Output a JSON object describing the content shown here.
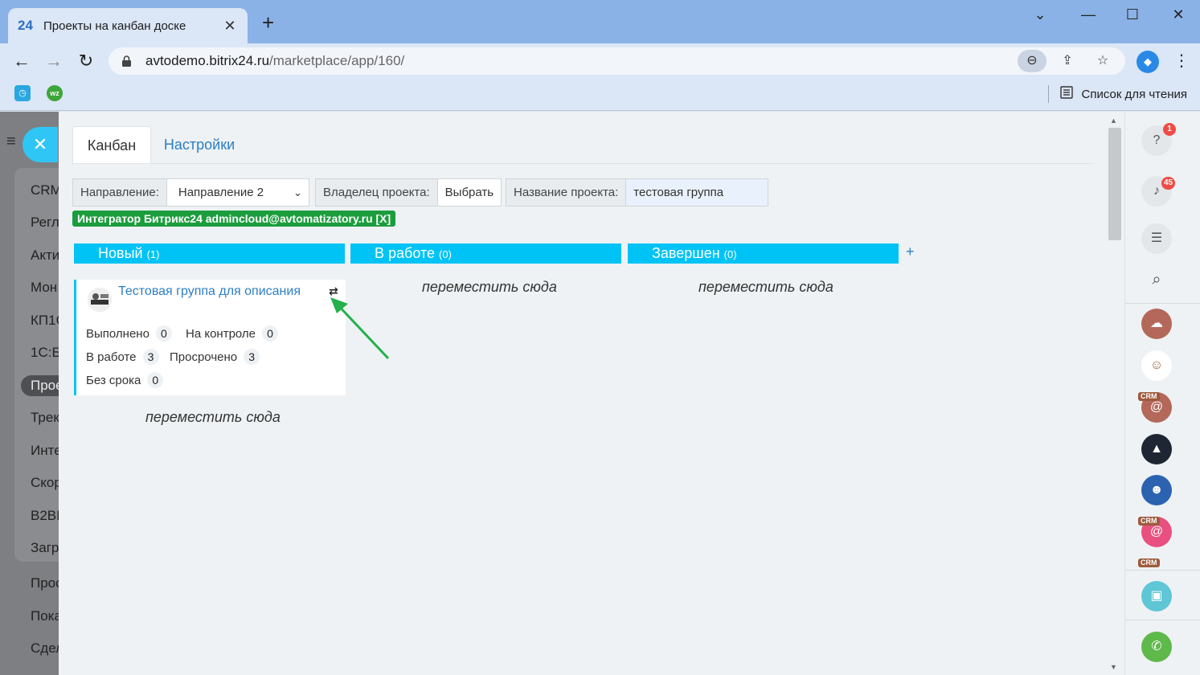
{
  "browser": {
    "tab_logo": "24",
    "tab_title": "Проекты на канбан доске",
    "tab_close": "✕",
    "new_tab": "+",
    "url_host": "avtodemo.bitrix24.ru",
    "url_path": "/marketplace/app/160/",
    "reading_list": "Список для чтения",
    "bookmark_wz": "wz"
  },
  "left_sidebar": {
    "items": [
      "CRM",
      "Регл",
      "Акти",
      "Мон",
      "КП1С",
      "1С:Б",
      "Проє",
      "Трек",
      "Инте",
      "Скор",
      "B2BI",
      "Загр",
      "Прос",
      "Пока",
      "Сдел"
    ]
  },
  "tabs": {
    "kanban": "Канбан",
    "settings": "Настройки"
  },
  "filter": {
    "direction_label": "Направление:",
    "direction_value": "Направление 2",
    "owner_label": "Владелец проекта:",
    "owner_button": "Выбрать",
    "name_label": "Название проекта:",
    "name_value": "тестовая группа"
  },
  "badge": "Интегратор Битрикс24 admincloud@avtomatizatory.ru [X]",
  "columns": [
    {
      "title": "Новый",
      "count": "(1)"
    },
    {
      "title": "В работе",
      "count": "(0)"
    },
    {
      "title": "Завершен",
      "count": "(0)"
    }
  ],
  "add_column": "+",
  "card": {
    "title": "Тестовая группа для описания",
    "move_icon": "⇄",
    "stats": {
      "done_label": "Выполнено",
      "done": "0",
      "control_label": "На контроле",
      "control": "0",
      "work_label": "В работе",
      "work": "3",
      "overdue_label": "Просрочено",
      "overdue": "3",
      "nodeadline_label": "Без срока",
      "nodeadline": "0"
    }
  },
  "drop_text": "переместить сюда",
  "right_sidebar": {
    "help_badge": "1",
    "notif_badge": "45",
    "crm_label": "CRM"
  },
  "colors": {
    "column_header": "#00c3f5",
    "green_badge": "#1c9d3d",
    "link": "#2d7ec4",
    "arrow": "#22b14c"
  }
}
